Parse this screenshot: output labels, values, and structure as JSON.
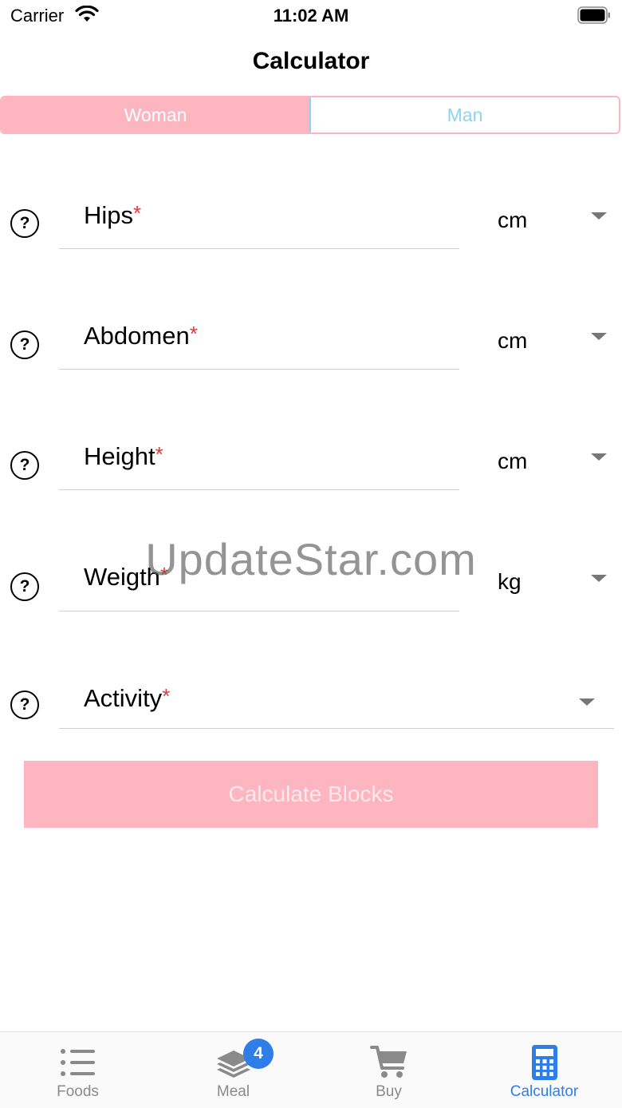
{
  "status_bar": {
    "carrier": "Carrier",
    "time": "11:02 AM"
  },
  "nav": {
    "title": "Calculator"
  },
  "gender": {
    "options": [
      "Woman",
      "Man"
    ],
    "selected": "Woman"
  },
  "fields": [
    {
      "label": "Hips",
      "required_mark": "*",
      "unit": "cm"
    },
    {
      "label": "Abdomen",
      "required_mark": "*",
      "unit": "cm"
    },
    {
      "label": "Height",
      "required_mark": "*",
      "unit": "cm"
    },
    {
      "label": "Weigth",
      "required_mark": "*",
      "unit": "kg"
    },
    {
      "label": "Activity",
      "required_mark": "*"
    }
  ],
  "calculate_button": "Calculate Blocks",
  "watermark": "UpdateStar.com",
  "tab_bar": {
    "items": [
      {
        "label": "Foods",
        "icon": "list-icon"
      },
      {
        "label": "Meal",
        "icon": "layers-icon",
        "badge": "4"
      },
      {
        "label": "Buy",
        "icon": "cart-icon"
      },
      {
        "label": "Calculator",
        "icon": "calculator-icon"
      }
    ],
    "active": "Calculator"
  },
  "colors": {
    "accent_pink": "#fdb6c0",
    "accent_blue": "#8fd3f2",
    "tab_active": "#2f7ee8",
    "required": "#e0393e"
  }
}
